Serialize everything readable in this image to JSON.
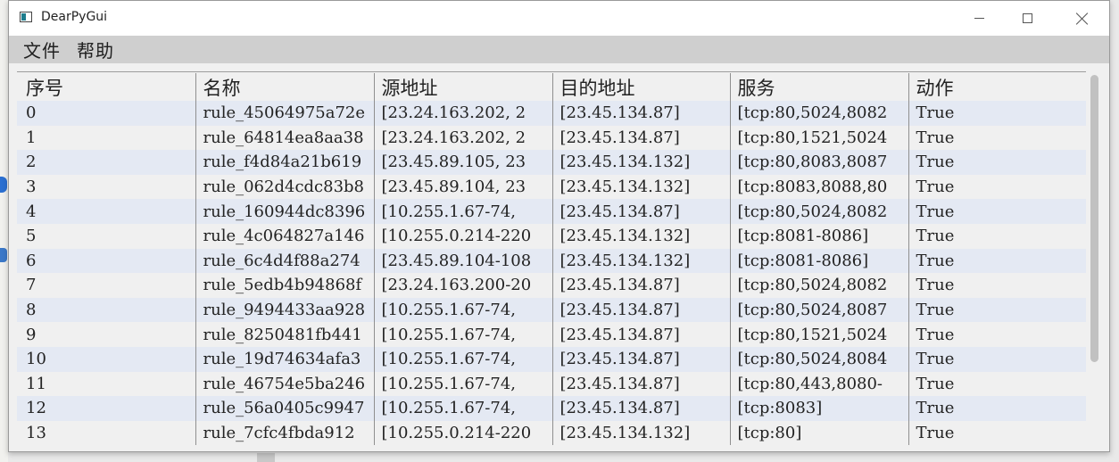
{
  "window": {
    "title": "DearPyGui"
  },
  "menu": {
    "items": [
      "文件",
      "帮助"
    ]
  },
  "table": {
    "headers": [
      "序号",
      "名称",
      "源地址",
      "目的地址",
      "服务",
      "动作"
    ],
    "rows": [
      [
        "0",
        "rule_45064975a72e",
        "[23.24.163.202, 2",
        "[23.45.134.87]",
        "[tcp:80,5024,8082",
        "True"
      ],
      [
        "1",
        "rule_64814ea8aa38",
        "[23.24.163.202, 2",
        "[23.45.134.87]",
        "[tcp:80,1521,5024",
        "True"
      ],
      [
        "2",
        "rule_f4d84a21b619",
        "[23.45.89.105, 23",
        "[23.45.134.132]",
        "[tcp:80,8083,8087",
        "True"
      ],
      [
        "3",
        "rule_062d4cdc83b8",
        "[23.45.89.104, 23",
        "[23.45.134.132]",
        "[tcp:8083,8088,80",
        "True"
      ],
      [
        "4",
        "rule_160944dc8396",
        "[10.255.1.67-74,",
        "[23.45.134.87]",
        "[tcp:80,5024,8082",
        "True"
      ],
      [
        "5",
        "rule_4c064827a146",
        "[10.255.0.214-220",
        "[23.45.134.132]",
        "[tcp:8081-8086]",
        "True"
      ],
      [
        "6",
        "rule_6c4d4f88a274",
        "[23.45.89.104-108",
        "[23.45.134.132]",
        "[tcp:8081-8086]",
        "True"
      ],
      [
        "7",
        "rule_5edb4b94868f",
        "[23.24.163.200-20",
        "[23.45.134.87]",
        "[tcp:80,5024,8082",
        "True"
      ],
      [
        "8",
        "rule_9494433aa928",
        "[10.255.1.67-74,",
        "[23.45.134.87]",
        "[tcp:80,5024,8087",
        "True"
      ],
      [
        "9",
        "rule_8250481fb441",
        "[10.255.1.67-74,",
        "[23.45.134.87]",
        "[tcp:80,1521,5024",
        "True"
      ],
      [
        "10",
        "rule_19d74634afa3",
        "[10.255.1.67-74,",
        "[23.45.134.87]",
        "[tcp:80,5024,8084",
        "True"
      ],
      [
        "11",
        "rule_46754e5ba246",
        "[10.255.1.67-74,",
        "[23.45.134.87]",
        "[tcp:80,443,8080-",
        "True"
      ],
      [
        "12",
        "rule_56a0405c9947",
        "[10.255.1.67-74,",
        "[23.45.134.87]",
        "[tcp:8083]",
        "True"
      ],
      [
        "13",
        "rule_7cfc4fbda912",
        "[10.255.0.214-220",
        "[23.45.134.132]",
        "[tcp:80]",
        "True"
      ]
    ]
  },
  "colors": {
    "row_stripe": "#e4e9f3",
    "row_plain": "#f0f0f0",
    "menubar": "#cfcfcf",
    "scroll_thumb": "#c1c1c1"
  },
  "icons": {
    "app": "app-window-icon",
    "min": "minimize-icon",
    "max": "maximize-icon",
    "close": "close-icon"
  }
}
